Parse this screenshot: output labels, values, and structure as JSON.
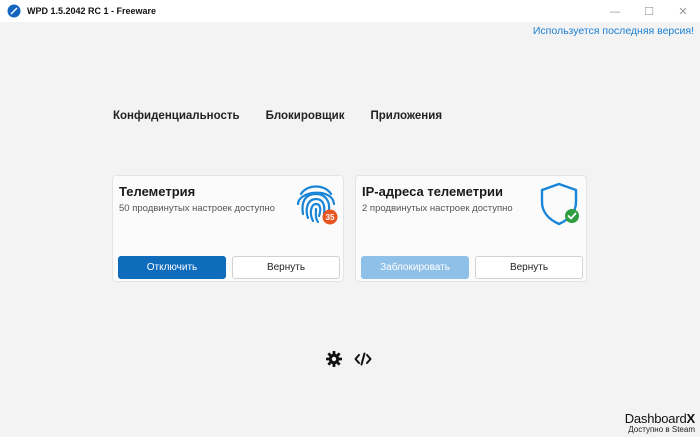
{
  "window": {
    "title": "WPD 1.5.2042 RC 1 - Freeware",
    "controls": {
      "minimize": "—",
      "maximize": "☐",
      "close": "✕"
    }
  },
  "update_status": "Используется последняя версия!",
  "nav": {
    "items": [
      {
        "label": "Конфиденциальность"
      },
      {
        "label": "Блокировщик"
      },
      {
        "label": "Приложения"
      }
    ]
  },
  "cards": [
    {
      "title": "Телеметрия",
      "subtitle": "50 продвинутых настроек доступно",
      "icon": "fingerprint-icon",
      "badge": "35",
      "primary_label": "Отключить",
      "secondary_label": "Вернуть"
    },
    {
      "title": "IP-адреса телеметрии",
      "subtitle": "2 продвинутых настроек доступно",
      "icon": "shield-check-icon",
      "primary_label": "Заблокировать",
      "secondary_label": "Вернуть"
    }
  ],
  "footer_icons": [
    "gear-icon",
    "code-icon"
  ],
  "watermark": {
    "brand_prefix": "Dashboard",
    "brand_suffix": "X",
    "subtitle": "Доступно в Steam"
  },
  "colors": {
    "accent": "#0f6cbd",
    "accent_disabled": "#8fc0e8",
    "link": "#1a7fd4",
    "badge": "#e8541f",
    "check": "#2e9e3e"
  }
}
